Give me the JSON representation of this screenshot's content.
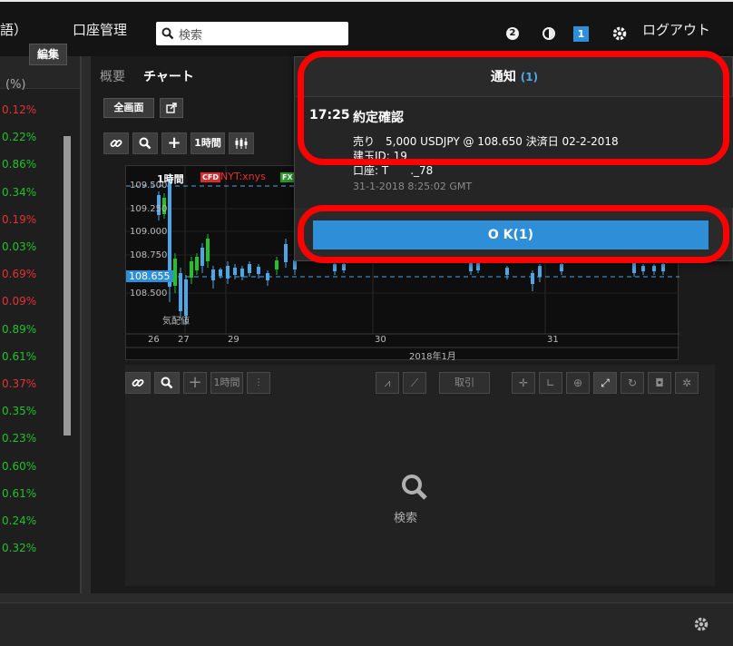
{
  "topbar": {
    "lang_fragment": "語）",
    "account_mgmt": "口座管理",
    "search_placeholder": "検索",
    "badge_circle": "2",
    "badge_square": "1",
    "logout": "ログアウト"
  },
  "left_panel": {
    "edit_label": "編集",
    "pct_header": "(%)",
    "items": [
      {
        "value": "0.12%",
        "dir": "down"
      },
      {
        "value": "0.22%",
        "dir": "up"
      },
      {
        "value": "0.86%",
        "dir": "up"
      },
      {
        "value": "0.34%",
        "dir": "up"
      },
      {
        "value": "0.19%",
        "dir": "down"
      },
      {
        "value": "0.03%",
        "dir": "up"
      },
      {
        "value": "0.69%",
        "dir": "down"
      },
      {
        "value": "0.09%",
        "dir": "down"
      },
      {
        "value": "0.89%",
        "dir": "up"
      },
      {
        "value": "0.61%",
        "dir": "up"
      },
      {
        "value": "0.37%",
        "dir": "down"
      },
      {
        "value": "0.35%",
        "dir": "up"
      },
      {
        "value": "0.23%",
        "dir": "up"
      },
      {
        "value": "0.60%",
        "dir": "up"
      },
      {
        "value": "0.61%",
        "dir": "up"
      },
      {
        "value": "0.24%",
        "dir": "up"
      },
      {
        "value": "0.32%",
        "dir": "up"
      }
    ]
  },
  "chart_panel": {
    "tab_overview": "概要",
    "tab_chart": "チャート",
    "fullscreen_btn": "全画面",
    "timeframe": "1時間",
    "cfd_badge": "CFD",
    "symbol": "NYT:xnys",
    "fx_badge": "FX",
    "price_ticks": [
      "109.500",
      "109.250",
      "109.000",
      "108.750",
      "108.500"
    ],
    "current_price": "108.655",
    "date_ticks": [
      "26",
      "27",
      "29",
      "30",
      "31"
    ],
    "month_label": "2018年1月",
    "volume_label": "気配値",
    "lower_timeframe": "1時間",
    "lower_trade_btn": "取引",
    "lower_search_text": "検索"
  },
  "notification": {
    "title": "通知",
    "count": "(1)",
    "time": "17:25",
    "heading": "約定確認",
    "line1": "売り　5,000 USDJPY @ 108.650 決済日 02-2-2018",
    "line2": "建玉ID: 19",
    "line3": "口座: T　　._78",
    "timestamp": "31-1-2018 8:25:02 GMT",
    "ok_label": "O K(1)"
  },
  "colors": {
    "accent_blue": "#2e8fd8",
    "up_green": "#22c22a",
    "down_red": "#e63232",
    "highlight_red": "#ff0000"
  }
}
